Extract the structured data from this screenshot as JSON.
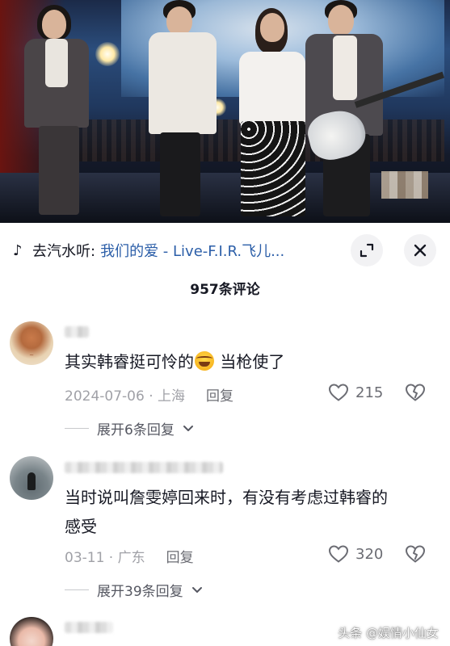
{
  "music": {
    "prefix": "去汽水听:",
    "song": "我们的爱 - Live-F.I.R.飞儿..."
  },
  "comments_header": "957条评论",
  "comments": [
    {
      "text_before_emoji": "其实韩睿挺可怜的",
      "text_after_emoji": "当枪使了",
      "date": "2024-07-06 · 上海",
      "reply_label": "回复",
      "likes": "215",
      "expand_label": "展开6条回复"
    },
    {
      "text_line1": "当时说叫詹雯婷回来时，有没有考虑过韩睿的",
      "text_line2": "感受",
      "date": "03-11 · 广东",
      "reply_label": "回复",
      "likes": "320",
      "expand_label": "展开39条回复"
    }
  ],
  "watermark": "头条 @娱情小仙女",
  "icons": {
    "music": "music-note-icon",
    "expand": "expand-icon",
    "close": "close-icon",
    "like": "heart-icon",
    "dislike": "broken-heart-icon",
    "chevron": "chevron-down-icon"
  }
}
